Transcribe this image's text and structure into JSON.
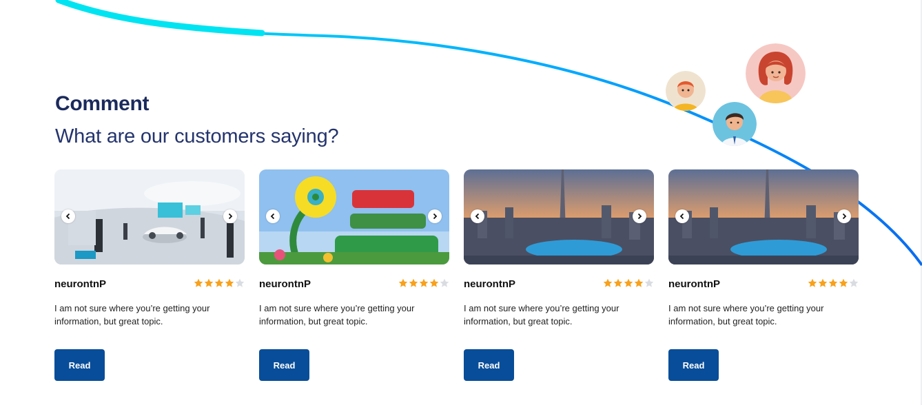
{
  "header": {
    "title": "Comment",
    "subtitle": "What are our customers saying?"
  },
  "colors": {
    "title": "#1b2a5c",
    "button": "#084d99",
    "star_filled": "#f7a11c",
    "star_empty": "#d9dce1",
    "curve": "#00b8ff"
  },
  "avatars": [
    {
      "icon": "boy-avatar-icon"
    },
    {
      "icon": "woman-avatar-icon"
    },
    {
      "icon": "man-avatar-icon"
    }
  ],
  "cards": [
    {
      "image_icon": "futuristic-showroom-photo",
      "name": "neurontnP",
      "rating": 4,
      "rating_max": 5,
      "text": "I am not sure where you’re getting your information, but great topic.",
      "button": "Read"
    },
    {
      "image_icon": "dubai-miracle-garden-photo",
      "name": "neurontnP",
      "rating": 4,
      "rating_max": 5,
      "text": "I am not sure where you’re getting your information, but great topic.",
      "button": "Read"
    },
    {
      "image_icon": "dubai-skyline-photo",
      "name": "neurontnP",
      "rating": 4,
      "rating_max": 5,
      "text": "I am not sure where you’re getting your information, but great topic.",
      "button": "Read"
    },
    {
      "image_icon": "dubai-skyline-photo",
      "name": "neurontnP",
      "rating": 4,
      "rating_max": 5,
      "text": "I am not sure where you’re getting your information, but great topic.",
      "button": "Read"
    }
  ]
}
